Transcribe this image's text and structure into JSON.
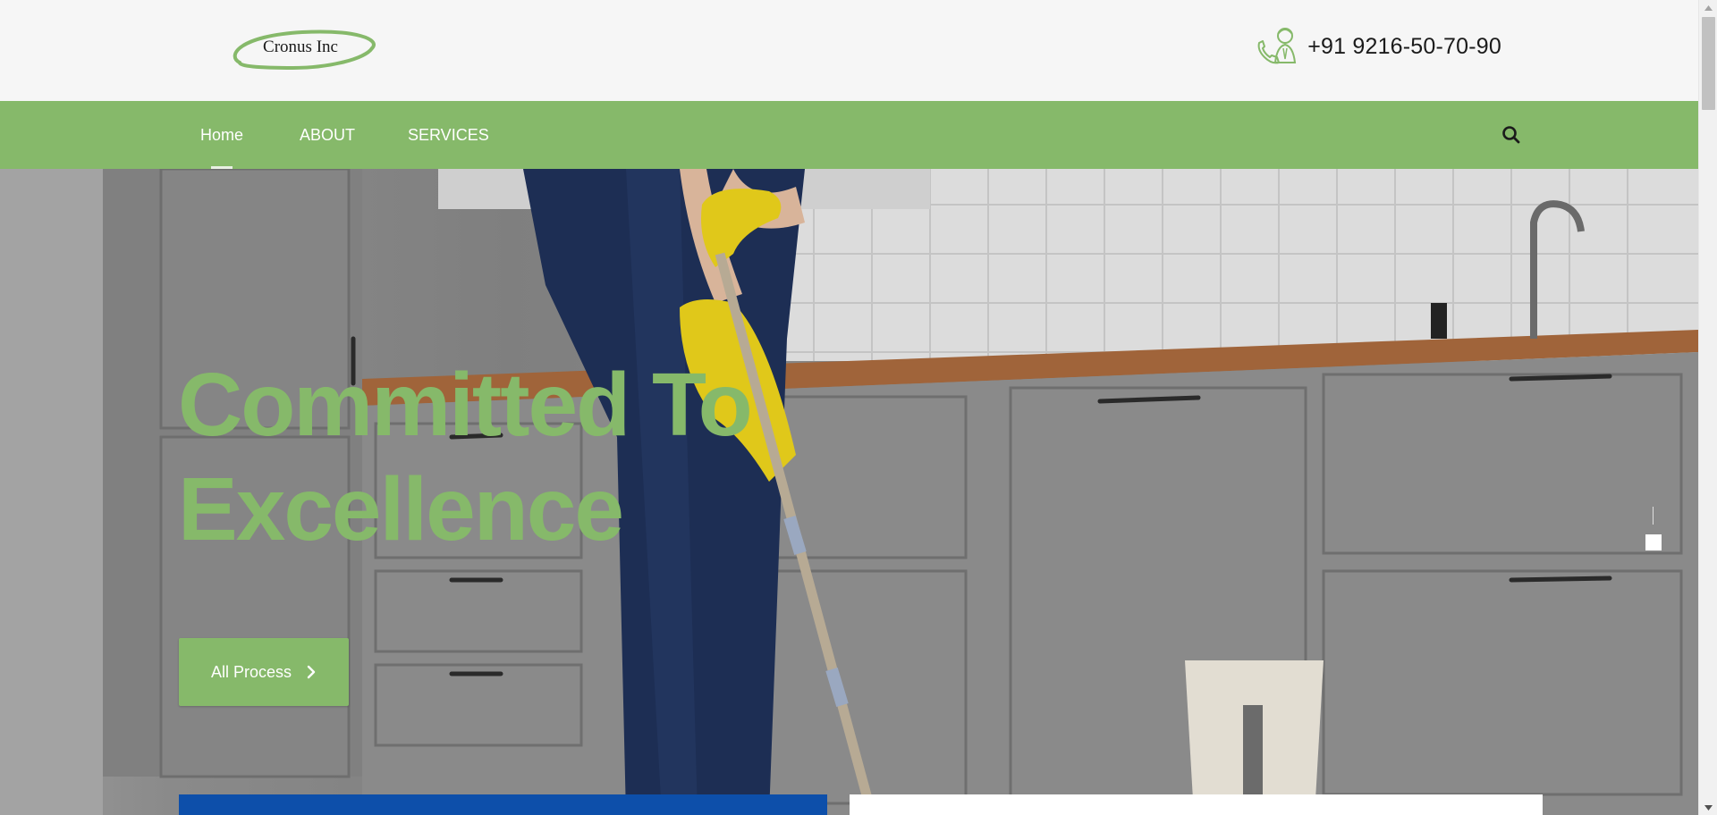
{
  "header": {
    "logo_text": "Cronus Inc",
    "phone_number": "+91 9216-50-70-90"
  },
  "nav": {
    "items": [
      {
        "label": "Home",
        "active": true
      },
      {
        "label": "ABOUT",
        "active": false
      },
      {
        "label": "SERVICES",
        "active": false
      }
    ]
  },
  "hero": {
    "title_line1": "Committed To",
    "title_line2": "Excellence",
    "cta_label": "All Process"
  },
  "colors": {
    "brand_green": "#86b96a",
    "card_blue": "#0d4faa"
  },
  "icons": [
    "phone-support-icon",
    "search-icon",
    "chevron-right-icon"
  ]
}
